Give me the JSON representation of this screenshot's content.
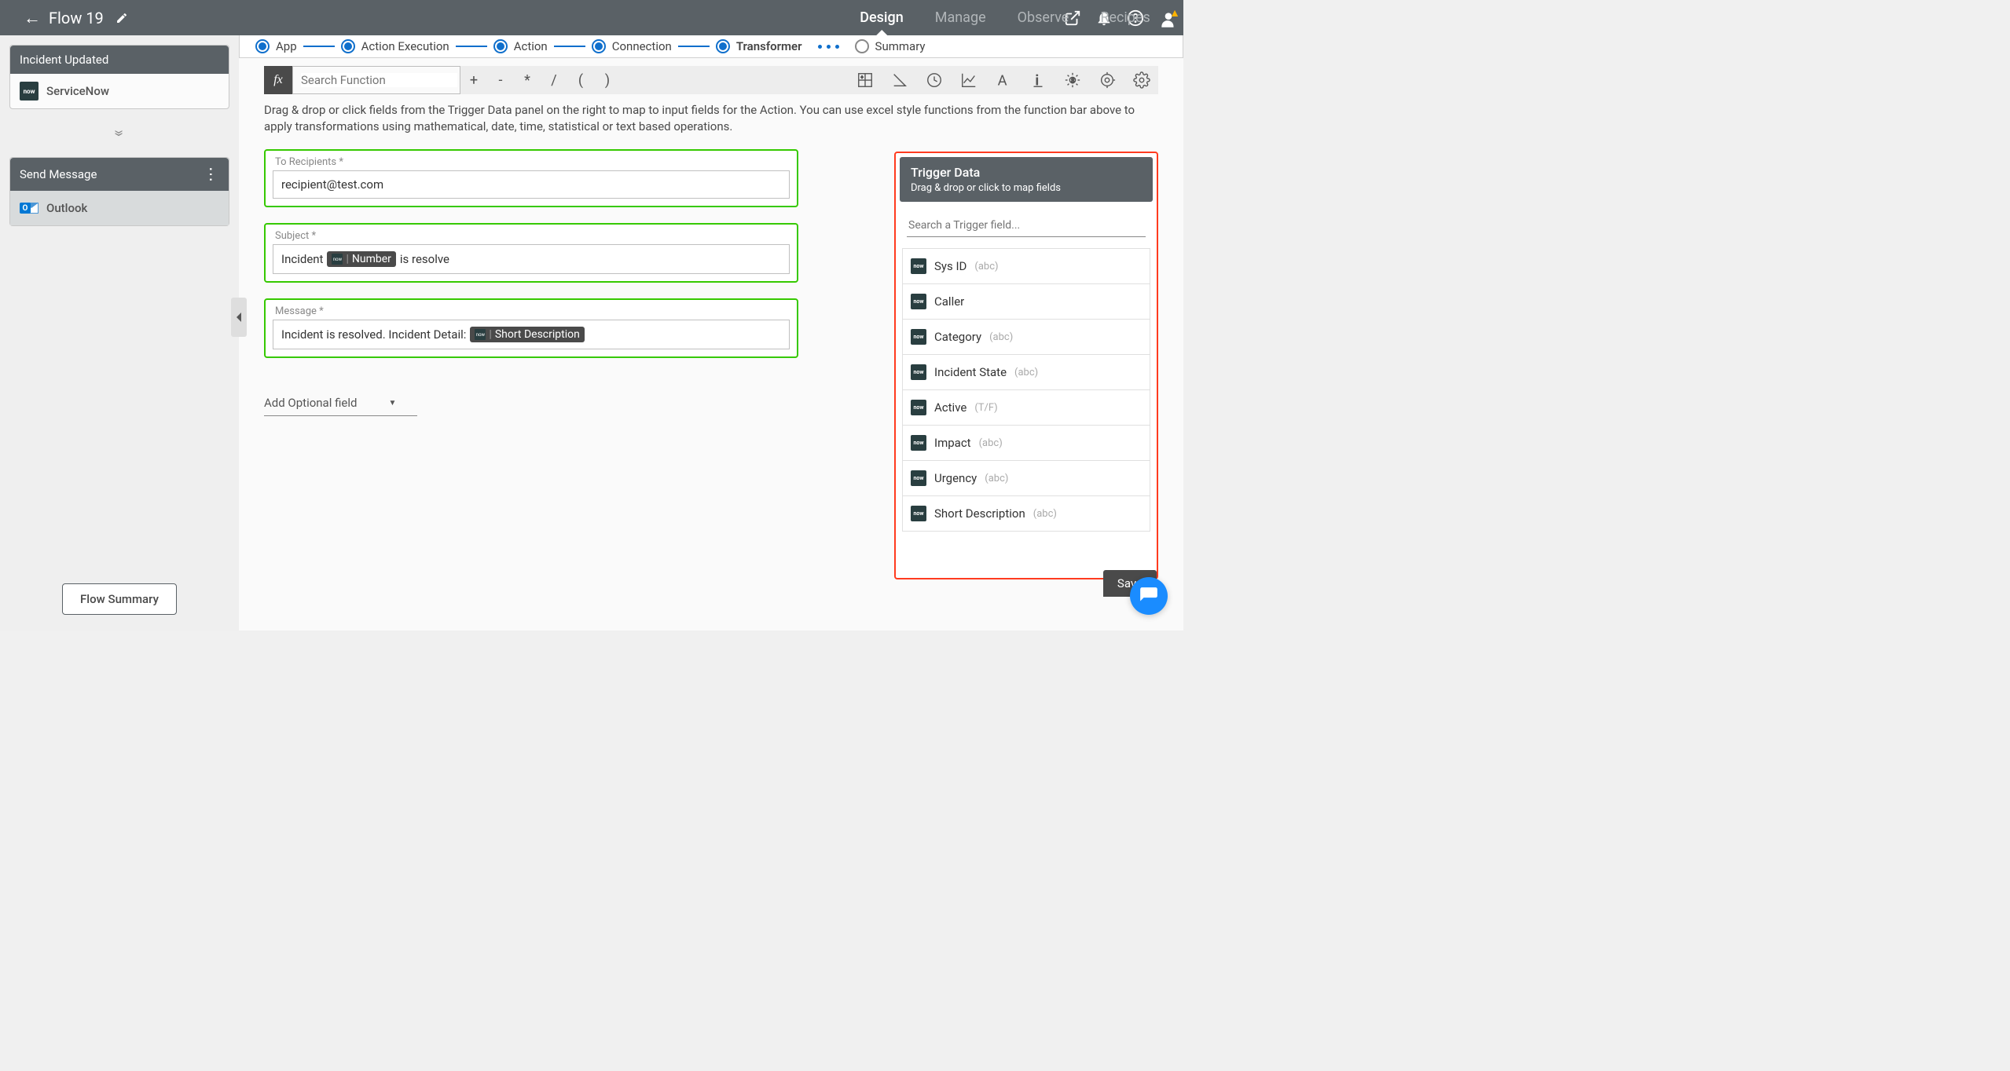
{
  "header": {
    "flow_title": "Flow 19",
    "tabs": [
      "Design",
      "Manage",
      "Observe",
      "Recipes"
    ],
    "active_tab": "Design"
  },
  "left": {
    "trigger_card_title": "Incident Updated",
    "trigger_app": "ServiceNow",
    "action_card_title": "Send Message",
    "action_app": "Outlook",
    "flow_summary_btn": "Flow Summary"
  },
  "wizard": {
    "steps": [
      "App",
      "Action Execution",
      "Action",
      "Connection",
      "Transformer",
      "Summary"
    ],
    "active": "Transformer"
  },
  "fx": {
    "search_placeholder": "Search Function",
    "ops": [
      "+",
      "-",
      "*",
      "/",
      "(",
      ")"
    ]
  },
  "help_text": "Drag & drop or click fields from the Trigger Data panel on the right to map to input fields for the Action. You can use excel style functions from the function bar above to apply transformations using mathematical, date, time, statistical or text based operations.",
  "form": {
    "to_label": "To Recipients *",
    "to_value": "recipient@test.com",
    "subject_label": "Subject *",
    "subject_pre": "Incident",
    "subject_chip": "Number",
    "subject_post": "is resolve",
    "message_label": "Message *",
    "message_pre": "Incident is resolved.  Incident Detail:",
    "message_chip": "Short Description",
    "add_optional": "Add Optional field"
  },
  "trigger_panel": {
    "title": "Trigger Data",
    "subtitle": "Drag & drop or click to map fields",
    "search_placeholder": "Search a Trigger field...",
    "fields": [
      {
        "name": "Sys ID",
        "type": "(abc)"
      },
      {
        "name": "Caller",
        "type": ""
      },
      {
        "name": "Category",
        "type": "(abc)"
      },
      {
        "name": "Incident State",
        "type": "(abc)"
      },
      {
        "name": "Active",
        "type": "(T/F)"
      },
      {
        "name": "Impact",
        "type": "(abc)"
      },
      {
        "name": "Urgency",
        "type": "(abc)"
      },
      {
        "name": "Short Description",
        "type": "(abc)"
      }
    ],
    "save": "Save"
  }
}
